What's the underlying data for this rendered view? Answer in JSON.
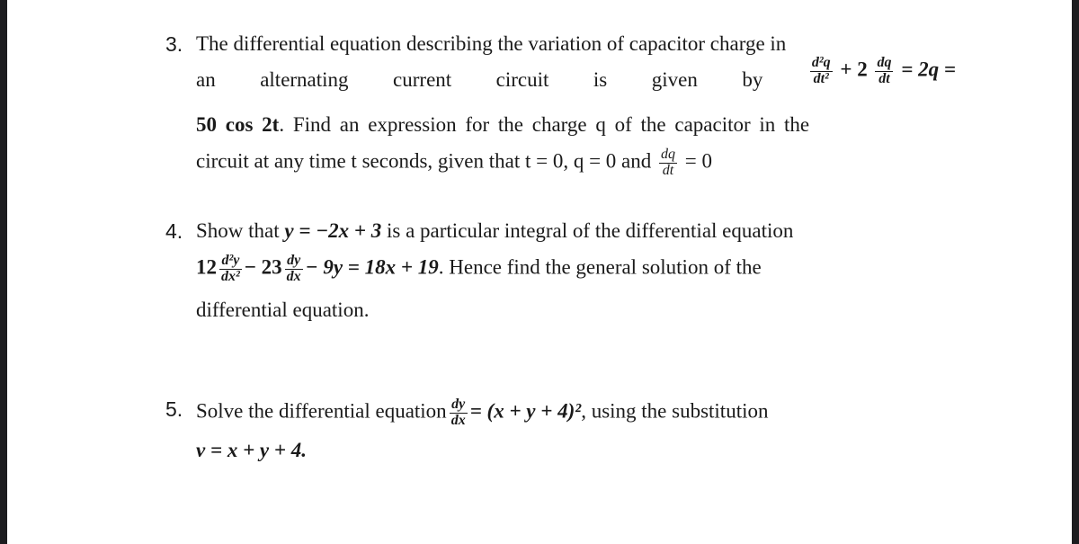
{
  "questions": [
    {
      "number": "3.",
      "line1": "The differential equation describing the variation of capacitor charge in",
      "line2_words": [
        "an",
        "alternating",
        "current",
        "circuit",
        "is",
        "given",
        "by"
      ],
      "eq": {
        "frac1_num": "d²q",
        "frac1_den": "dt²",
        "plus": "+ 2",
        "frac2_num": "dq",
        "frac2_den": "dt",
        "rest": "= 2q ="
      },
      "line3_math": "50 cos 2t",
      "line3_text": ". Find an expression for the charge q of the capacitor in the",
      "line4_text": "circuit at any time t seconds, given that t = 0, q = 0 and",
      "line4_frac_num": "dq",
      "line4_frac_den": "dt",
      "line4_end": "= 0"
    },
    {
      "number": "4.",
      "line1_a": "Show that",
      "line1_math": "y = −2x + 3",
      "line1_b": "is a particular integral of the differential equation",
      "coef1": "12",
      "frac1_num": "d²y",
      "frac1_den": "dx²",
      "coef2": "− 23",
      "frac2_num": "dy",
      "frac2_den": "dx",
      "rest_math": "− 9y = 18x + 19",
      "rest_text": ". Hence find the general solution of the",
      "line3": "differential equation."
    },
    {
      "number": "5.",
      "line1_a": "Solve the differential equation",
      "frac_num": "dy",
      "frac_den": "dx",
      "line1_math": "= (x + y + 4)²",
      "line1_b": ", using the substitution",
      "line2_math": "v = x + y + 4."
    }
  ]
}
